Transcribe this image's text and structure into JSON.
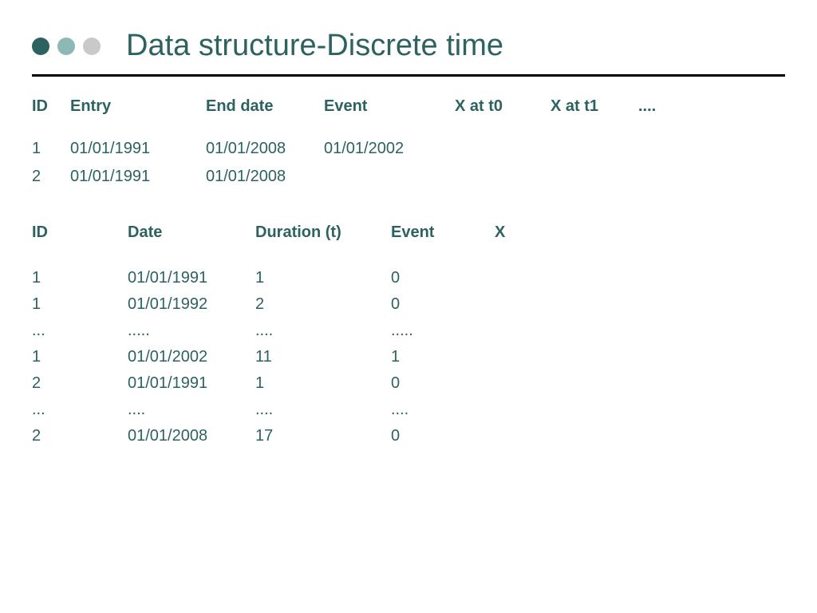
{
  "title": "Data structure-Discrete time",
  "colors": {
    "accent": "#2c6260",
    "dot2": "#8cb9b6",
    "dot3": "#c8cac9"
  },
  "table1": {
    "headers": [
      "ID",
      "Entry",
      "End date",
      "Event",
      "X at t0",
      "X at t1",
      "...."
    ],
    "rows": [
      [
        "1",
        "01/01/1991",
        "01/01/2008",
        "01/01/2002",
        "",
        "",
        ""
      ],
      [
        "2",
        "01/01/1991",
        "01/01/2008",
        "",
        "",
        "",
        ""
      ]
    ]
  },
  "table2": {
    "headers": [
      "ID",
      "Date",
      "Duration (t)",
      "Event",
      "X"
    ],
    "rows": [
      [
        "1",
        "01/01/1991",
        "1",
        "0",
        ""
      ],
      [
        "1",
        "01/01/1992",
        "2",
        "0",
        ""
      ],
      [
        "...",
        ".....",
        "....",
        ".....",
        ""
      ],
      [
        "1",
        "01/01/2002",
        "11",
        "1",
        ""
      ],
      [
        "2",
        "01/01/1991",
        "1",
        "0",
        ""
      ],
      [
        "...",
        "....",
        "....",
        "....",
        ""
      ],
      [
        "2",
        "01/01/2008",
        "17",
        "0",
        ""
      ]
    ]
  }
}
